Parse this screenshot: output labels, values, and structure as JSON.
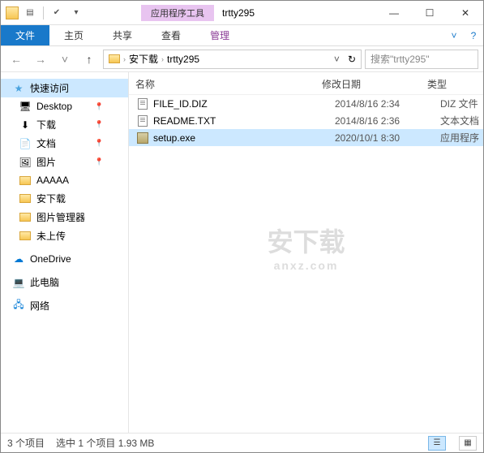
{
  "titlebar": {
    "tool_context": "应用程序工具",
    "title": "trtty295"
  },
  "win_controls": {
    "min": "—",
    "max": "☐",
    "close": "✕"
  },
  "ribbon": {
    "file": "文件",
    "home": "主页",
    "share": "共享",
    "view": "查看",
    "manage": "管理"
  },
  "addrbar": {
    "seg1": "安下载",
    "seg2": "trtty295",
    "search_placeholder": "搜索\"trtty295\""
  },
  "nav": {
    "quick_access": "快速访问",
    "items": [
      {
        "label": "Desktop"
      },
      {
        "label": "下载"
      },
      {
        "label": "文档"
      },
      {
        "label": "图片"
      },
      {
        "label": "AAAAA"
      },
      {
        "label": "安下载"
      },
      {
        "label": "图片管理器"
      },
      {
        "label": "未上传"
      }
    ],
    "onedrive": "OneDrive",
    "thispc": "此电脑",
    "network": "网络"
  },
  "columns": {
    "name": "名称",
    "date": "修改日期",
    "type": "类型"
  },
  "files": [
    {
      "name": "FILE_ID.DIZ",
      "date": "2014/8/16 2:34",
      "type": "DIZ 文件",
      "icon": "doc"
    },
    {
      "name": "README.TXT",
      "date": "2014/8/16 2:36",
      "type": "文本文档",
      "icon": "doc"
    },
    {
      "name": "setup.exe",
      "date": "2020/10/1 8:30",
      "type": "应用程序",
      "icon": "exe",
      "selected": true
    }
  ],
  "watermark": {
    "main": "安下载",
    "sub": "anxz.com"
  },
  "status": {
    "count": "3 个项目",
    "selection": "选中 1 个项目  1.93 MB"
  }
}
